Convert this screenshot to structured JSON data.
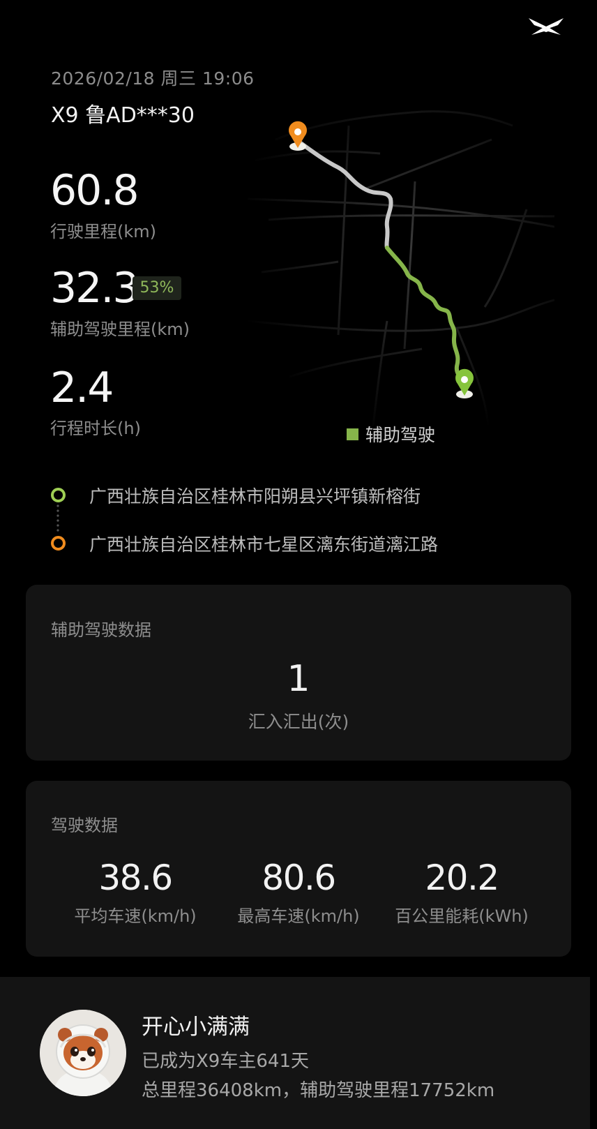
{
  "header": {
    "datetime": "2026/02/18 周三 19:06",
    "vehicle": "X9 鲁AD***30",
    "logo_icon": "xpeng-logo-icon"
  },
  "stats": {
    "distance_value": "60.8",
    "distance_label": "行驶里程(km)",
    "assist_value": "32.3",
    "assist_percent": "53%",
    "assist_label": "辅助驾驶里程(km)",
    "duration_value": "2.4",
    "duration_label": "行程时长(h)"
  },
  "map": {
    "legend_label": "辅助驾驶",
    "assist_color": "#86b54a",
    "manual_color": "#c8c8c8",
    "start_pin_color": "#f08c1e",
    "end_pin_color": "#86c43c"
  },
  "route": {
    "start": "广西壮族自治区桂林市阳朔县兴坪镇新榕街",
    "end": "广西壮族自治区桂林市七星区漓东街道漓江路"
  },
  "assist_card": {
    "title": "辅助驾驶数据",
    "value": "1",
    "label": "汇入汇出(次)"
  },
  "driving_card": {
    "title": "驾驶数据",
    "metrics": [
      {
        "value": "38.6",
        "label": "平均车速(km/h)"
      },
      {
        "value": "80.6",
        "label": "最高车速(km/h)"
      },
      {
        "value": "20.2",
        "label": "百公里能耗(kWh)"
      }
    ]
  },
  "profile": {
    "name": "开心小满满",
    "owner_days": "已成为X9车主641天",
    "mileage": "总里程36408km，辅助驾驶里程17752km"
  }
}
